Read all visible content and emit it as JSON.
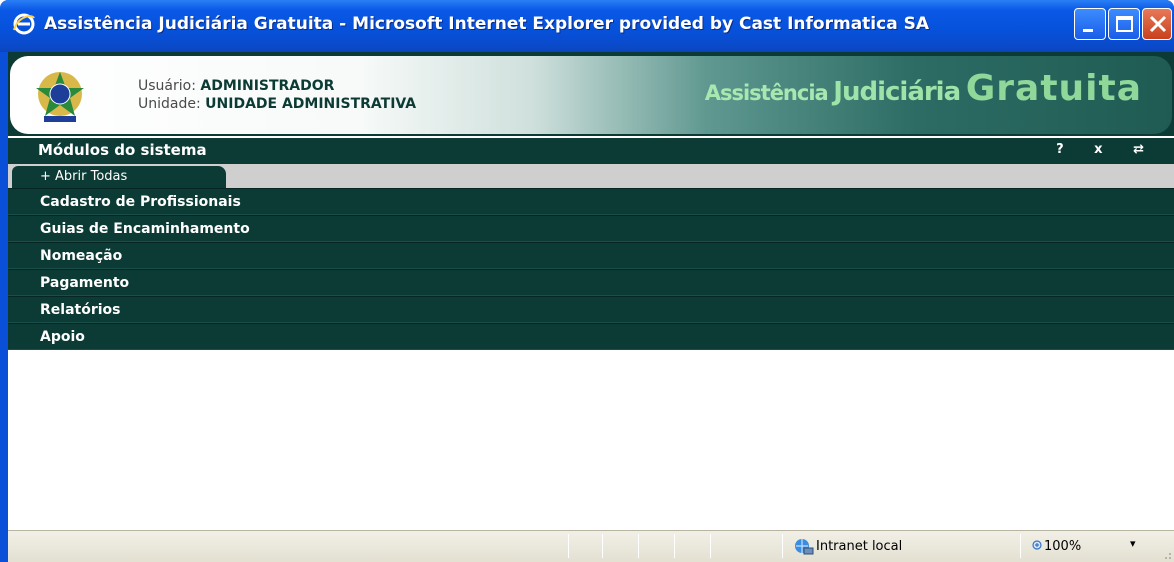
{
  "window": {
    "title": "Assistência Judiciária Gratuita - Microsoft Internet Explorer provided by Cast Informatica SA"
  },
  "header": {
    "user_label": "Usuário:",
    "user_value": "ADMINISTRADOR",
    "unit_label": "Unidade:",
    "unit_value": "UNIDADE ADMINISTRATIVA",
    "brand_part1": "Assistência",
    "brand_part2": "Judiciária",
    "brand_part3": "Gratuita"
  },
  "modules": {
    "title": "Módulos do sistema",
    "help_icon": "?",
    "close_icon": "x",
    "toggle_icon": "⇄",
    "open_all_label": "+ Abrir Todas",
    "items": [
      {
        "label": "Cadastro de Profissionais"
      },
      {
        "label": "Guias de Encaminhamento"
      },
      {
        "label": "Nomeação"
      },
      {
        "label": "Pagamento"
      },
      {
        "label": "Relatórios"
      },
      {
        "label": "Apoio"
      }
    ]
  },
  "statusbar": {
    "zone": "Intranet local",
    "zoom": "100%"
  },
  "colors": {
    "titlebar": "#0a58e6",
    "menu_bg": "#0c3b36",
    "brand_text": "#a8e8b0"
  }
}
